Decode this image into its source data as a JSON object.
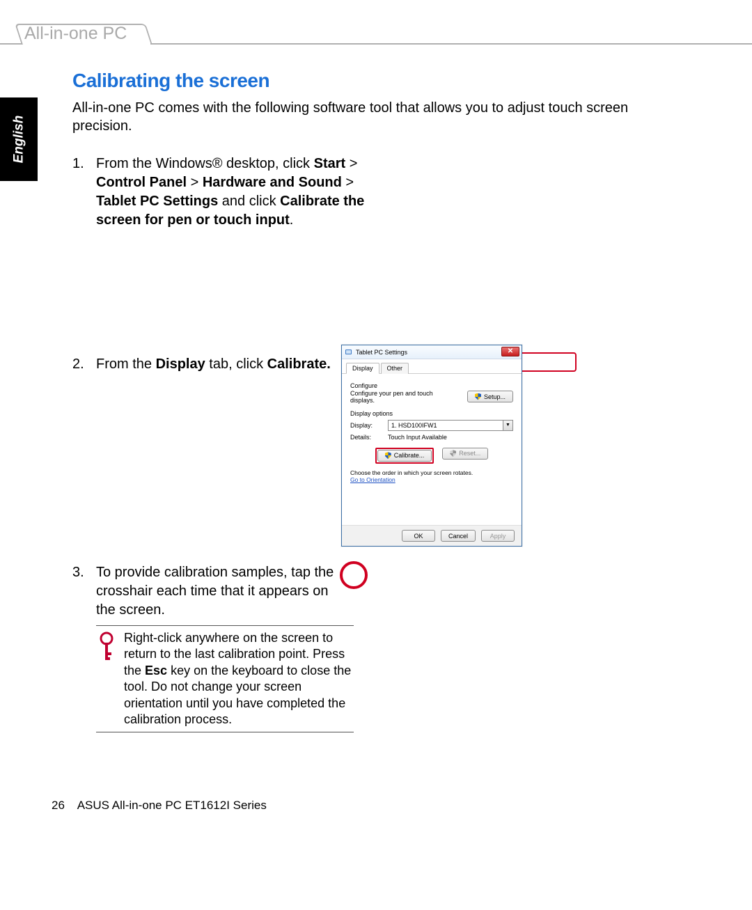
{
  "header": {
    "tab_label": "All-in-one PC"
  },
  "language_tab": "English",
  "section": {
    "title": "Calibrating the screen",
    "intro": "All-in-one PC comes with the following software tool that allows you to adjust touch screen precision."
  },
  "steps": {
    "s1": {
      "num": "1.",
      "parts": {
        "a": "From the Windows® desktop, click ",
        "b_bold": "Start",
        "c": " > ",
        "d_bold": "Control Panel",
        "e": " > ",
        "f_bold": "Hardware and Sound",
        "g": " > ",
        "h_bold": "Tablet PC Settings",
        "i": " and click ",
        "j_bold": "Calibrate the screen for pen or touch input",
        "k": "."
      }
    },
    "s2": {
      "num": "2.",
      "parts": {
        "a": "From the ",
        "b_bold": "Display",
        "c": " tab, click ",
        "d_bold": "Calibrate.",
        "e": ""
      }
    },
    "s3": {
      "num": "3.",
      "text": "To provide calibration samples, tap the crosshair each time that it appears on the screen."
    }
  },
  "note": {
    "parts": {
      "a": "Right-click anywhere on the screen to return to the last calibration point. Press the ",
      "b_bold": "Esc",
      "c": " key on the keyboard to close the tool. Do not change your screen orientation until you have completed the calibration process."
    }
  },
  "dialog": {
    "title": "Tablet PC Settings",
    "close_glyph": "✕",
    "tabs": {
      "display": "Display",
      "other": "Other"
    },
    "configure_label": "Configure",
    "configure_text": "Configure your pen and touch displays.",
    "setup_btn": "Setup...",
    "display_options_label": "Display options",
    "display_label": "Display:",
    "display_value": "1. HSD100IFW1",
    "select_arrow": "▼",
    "details_label": "Details:",
    "details_value": "Touch Input Available",
    "calibrate_btn": "Calibrate...",
    "reset_btn": "Reset...",
    "order_text": "Choose the order in which your screen rotates.",
    "orientation_link": "Go to Orientation",
    "ok": "OK",
    "cancel": "Cancel",
    "apply": "Apply"
  },
  "footer": {
    "page_number": "26",
    "product": "ASUS All-in-one PC ET1612I Series"
  }
}
